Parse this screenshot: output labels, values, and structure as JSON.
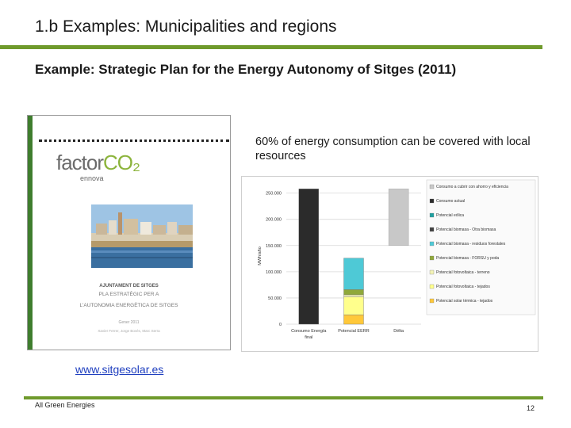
{
  "slide": {
    "title": "1.b Examples: Municipalities and regions",
    "subtitle": "Example: Strategic Plan for the Energy Autonomy of Sitges (2011)",
    "callout": "60% of energy consumption can be covered with local resources",
    "link": "www.sitgesolar.es",
    "footer": "All Green Energies",
    "page_number": "12",
    "accent_color": "#6f9a2c"
  },
  "cover": {
    "logo_main": "factor",
    "logo_co2": "CO₂",
    "logo_sub": "ennova",
    "heading1": "AJUNTAMENT DE SITGES",
    "heading2": "PLA ESTRATÈGIC PER A",
    "heading3": "L'AUTONOMIA ENERGÈTICA DE SITGES",
    "date": "Gener 2011",
    "authors": "Xavier Ferrer, Jorge Bovés, Marc Serra"
  },
  "chart_data": {
    "type": "bar",
    "stacked": true,
    "categories": [
      "Consumo Energía final",
      "Potencial EERR",
      "Délta"
    ],
    "ylabel": "MWh/año",
    "ylim": [
      0,
      260000
    ],
    "yticks": [
      0,
      50000,
      100000,
      150000,
      200000,
      250000
    ],
    "ytick_labels": [
      "0",
      "50.000",
      "100.000",
      "150.000",
      "200.000",
      "250.000"
    ],
    "grid": true,
    "legend_position": "right",
    "series": [
      {
        "name": "Consumo a cubrir con ahorro y eficiencia",
        "color": "#c8c8c8",
        "values": [
          0,
          0,
          0
        ]
      },
      {
        "name": "Consumo actual",
        "color": "#2b2b2b",
        "values": [
          258000,
          0,
          0
        ]
      },
      {
        "name": "Potencial eólica",
        "color": "#1fa0a0",
        "values": [
          0,
          0,
          0
        ]
      },
      {
        "name": "Potencial biomasa - Otra biomasa",
        "color": "#404040",
        "values": [
          0,
          0,
          0
        ]
      },
      {
        "name": "Potencial biomasa - residuos forestales",
        "color": "#4ec9d6",
        "values": [
          0,
          60000,
          0
        ]
      },
      {
        "name": "Potencial biomasa - FORSU y poda",
        "color": "#8fa83a",
        "values": [
          0,
          10000,
          0
        ]
      },
      {
        "name": "Potencial fotovoltaica - terreno",
        "color": "#f3f3b6",
        "values": [
          0,
          4000,
          0
        ]
      },
      {
        "name": "Potencial fotovoltaica - tejados",
        "color": "#ffff8c",
        "values": [
          0,
          34000,
          0
        ]
      },
      {
        "name": "Potencial solar térmica - tejados",
        "color": "#ffc83a",
        "values": [
          0,
          18000,
          0
        ]
      }
    ],
    "delta_range": [
      150000,
      258000
    ],
    "delta_color": "#c8c8c8"
  }
}
